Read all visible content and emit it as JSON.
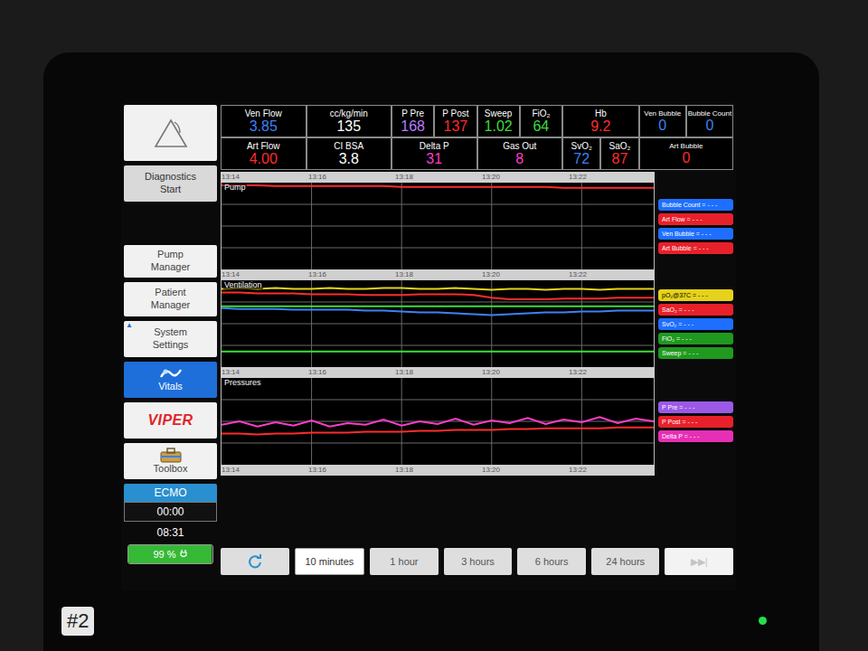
{
  "header": {
    "groups": [
      {
        "rows": [
          [
            {
              "label": "Ven Flow",
              "value": "3.85",
              "color": "#3b82f6"
            }
          ],
          [
            {
              "label": "Art Flow",
              "value": "4.00",
              "color": "#ff2b2b"
            }
          ]
        ]
      },
      {
        "rows": [
          [
            {
              "label": "cc/kg/min",
              "value": "135",
              "color": "#ffffff"
            }
          ],
          [
            {
              "label": "CI BSA",
              "value": "3.8",
              "color": "#ffffff"
            }
          ]
        ]
      },
      {
        "rows": [
          [
            {
              "label": "P Pre",
              "value": "168",
              "color": "#b77bff"
            },
            {
              "label": "P Post",
              "value": "137",
              "color": "#ff2b2b"
            }
          ],
          [
            {
              "label": "Delta P",
              "value": "31",
              "color": "#ff3cc8"
            }
          ]
        ]
      },
      {
        "rows": [
          [
            {
              "label": "Sweep",
              "value": "1.02",
              "color": "#3ddc3d"
            },
            {
              "label": "FiO₂",
              "value": "64",
              "color": "#3ddc3d"
            }
          ],
          [
            {
              "label": "Gas Out",
              "value": "8",
              "color": "#ff3cc8"
            }
          ]
        ]
      },
      {
        "rows": [
          [
            {
              "label": "Hb",
              "value": "9.2",
              "color": "#ff2b2b"
            }
          ],
          [
            {
              "label": "SvO₂",
              "value": "72",
              "color": "#3b82f6"
            },
            {
              "label": "SaO₂",
              "value": "87",
              "color": "#ff2b2b"
            }
          ]
        ]
      },
      {
        "rows": [
          [
            {
              "label": "Ven Bubble",
              "value": "0",
              "color": "#3b82f6"
            },
            {
              "label": "Bubble Count",
              "value": "0",
              "color": "#3b82f6"
            }
          ],
          [
            {
              "label": "Art Bubble",
              "value": "0",
              "color": "#ff2b2b"
            }
          ]
        ]
      }
    ]
  },
  "sidebar": {
    "top_items": [
      {
        "kind": "alert",
        "selected": false
      },
      {
        "kind": "button",
        "label": "Diagnostics\nStart",
        "selected": false
      }
    ],
    "items": [
      {
        "kind": "button",
        "label": "Pump\nManager",
        "selected": false
      },
      {
        "kind": "button",
        "label": "Patient\nManager",
        "selected": false
      },
      {
        "kind": "button",
        "label": "System\nSettings",
        "marker": "▲",
        "selected": false
      },
      {
        "kind": "icon-button",
        "label": "Vitals",
        "selected": true
      },
      {
        "kind": "logo",
        "label": "VIPER",
        "selected": false
      },
      {
        "kind": "icon-button",
        "label": "Toolbox",
        "selected": false
      }
    ],
    "mode": "ECMO",
    "timer": "00:00",
    "clock": "08:31",
    "battery": {
      "label": "99 %",
      "level": 0.99
    }
  },
  "chart": {
    "ticks": [
      "13:14",
      "13:16",
      "13:18",
      "13:20",
      "13:22"
    ],
    "panels": [
      {
        "title": "Pump",
        "series": [
          {
            "name": "Art Flow",
            "color": "#ff2b2b",
            "values": [
              97,
              97,
              97,
              96,
              96,
              96,
              96,
              96,
              96,
              96,
              95,
              95,
              95,
              95,
              95,
              95,
              95,
              95,
              95,
              94,
              94,
              94,
              94,
              94,
              94
            ]
          }
        ],
        "legend": [
          {
            "text": "Bubble Count = - - -",
            "color": "#1e6fff"
          },
          {
            "text": "Art Flow = - - -",
            "color": "#e8202a"
          },
          {
            "text": "Ven Bubble = - - -",
            "color": "#1e6fff"
          },
          {
            "text": "Art Bubble = - - -",
            "color": "#e8202a"
          }
        ]
      },
      {
        "title": "Ventilation",
        "series": [
          {
            "name": "pO₂@37C",
            "color": "#e6d21a",
            "values": [
              90,
              91,
              90,
              91,
              90,
              90,
              91,
              90,
              90,
              91,
              91,
              90,
              90,
              91,
              90,
              89,
              90,
              90,
              89,
              90,
              90,
              89,
              90,
              90,
              90
            ]
          },
          {
            "name": "SaO₂",
            "color": "#ff2b2b",
            "values": [
              86,
              86,
              85,
              85,
              85,
              84,
              84,
              84,
              83,
              83,
              83,
              84,
              84,
              84,
              83,
              80,
              78,
              78,
              78,
              79,
              79,
              79,
              80,
              80,
              80
            ]
          },
          {
            "name": "FiO₂",
            "color": "#3ddc3d",
            "values": [
              70,
              70,
              70,
              70,
              70,
              70,
              70,
              70,
              70,
              70,
              70,
              70,
              70,
              70,
              70,
              70,
              70,
              70,
              70,
              70,
              70,
              70,
              70,
              70,
              70
            ]
          },
          {
            "name": "SvO₂",
            "color": "#3b82f6",
            "values": [
              68,
              67,
              67,
              67,
              66,
              66,
              66,
              66,
              65,
              65,
              64,
              63,
              63,
              62,
              61,
              60,
              61,
              62,
              63,
              63,
              64,
              64,
              65,
              65,
              65
            ]
          },
          {
            "name": "Sweep",
            "color": "#3ddc3d",
            "values": [
              18,
              18,
              18,
              18,
              18,
              18,
              18,
              18,
              18,
              18,
              18,
              18,
              18,
              18,
              18,
              18,
              18,
              18,
              18,
              18,
              18,
              18,
              18,
              18,
              18
            ]
          }
        ],
        "legend": [
          {
            "text": "pO₂@37C = - - -",
            "color": "#e6d21a"
          },
          {
            "text": "SaO₂ = - - -",
            "color": "#e8202a"
          },
          {
            "text": "SvO₂ = - - -",
            "color": "#1e6fff"
          },
          {
            "text": "FiO₂ = - - -",
            "color": "#1f9a1f"
          },
          {
            "text": "Sweep = - - -",
            "color": "#1f9a1f"
          }
        ]
      },
      {
        "title": "Pressures",
        "series": [
          {
            "name": "P Post",
            "color": "#ff2b2b",
            "values": [
              36,
              36,
              35,
              36,
              36,
              37,
              37,
              37,
              38,
              38,
              38,
              39,
              39,
              40,
              40,
              40,
              41,
              41,
              42,
              42,
              42,
              42,
              43,
              43,
              43
            ]
          },
          {
            "name": "Delta P",
            "color": "#ff3cc8",
            "values": [
              46,
              50,
              44,
              49,
              45,
              51,
              44,
              48,
              46,
              52,
              45,
              50,
              47,
              53,
              46,
              51,
              48,
              54,
              47,
              52,
              49,
              55,
              48,
              53,
              50
            ]
          }
        ],
        "legend": [
          {
            "text": "P Pre = - - -",
            "color": "#9b59e6"
          },
          {
            "text": "P Post = - - -",
            "color": "#e8202a"
          },
          {
            "text": "Delta P = - - -",
            "color": "#e62fb4"
          }
        ]
      }
    ]
  },
  "range_buttons": [
    {
      "kind": "icon",
      "selected": false,
      "disabled": false
    },
    {
      "kind": "text",
      "label": "10 minutes",
      "selected": true,
      "disabled": false
    },
    {
      "kind": "text",
      "label": "1 hour",
      "selected": false,
      "disabled": false
    },
    {
      "kind": "text",
      "label": "3 hours",
      "selected": false,
      "disabled": false
    },
    {
      "kind": "text",
      "label": "6 hours",
      "selected": false,
      "disabled": false
    },
    {
      "kind": "text",
      "label": "24 hours",
      "selected": false,
      "disabled": false
    },
    {
      "kind": "text",
      "label": "▶▶|",
      "selected": false,
      "disabled": true
    }
  ],
  "bezel": {
    "label": "#2"
  }
}
